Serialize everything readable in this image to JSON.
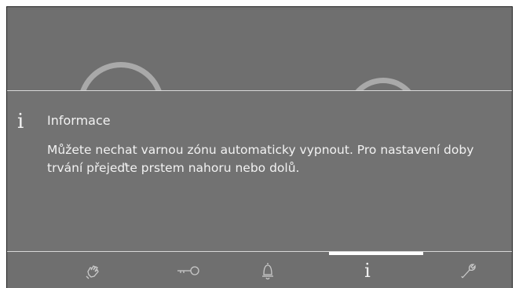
{
  "info": {
    "title": "Informace",
    "body": "Můžete nechat varnou zónu automaticky vypnout. Pro nastavení doby trvání přejeďte prstem nahoru nebo dolů.",
    "icon": "info-icon"
  },
  "navbar": {
    "items": [
      {
        "name": "wipe-protection",
        "icon": "hand-wipe-icon"
      },
      {
        "name": "child-lock",
        "icon": "key-icon"
      },
      {
        "name": "timer-alarm",
        "icon": "bell-icon"
      },
      {
        "name": "information",
        "icon": "info-icon",
        "glyph": "i",
        "active": true
      },
      {
        "name": "settings",
        "icon": "wrench-icon"
      }
    ]
  },
  "colors": {
    "background": "#6f6f6f",
    "text": "#f2f2f2",
    "active_indicator": "#ffffff"
  }
}
